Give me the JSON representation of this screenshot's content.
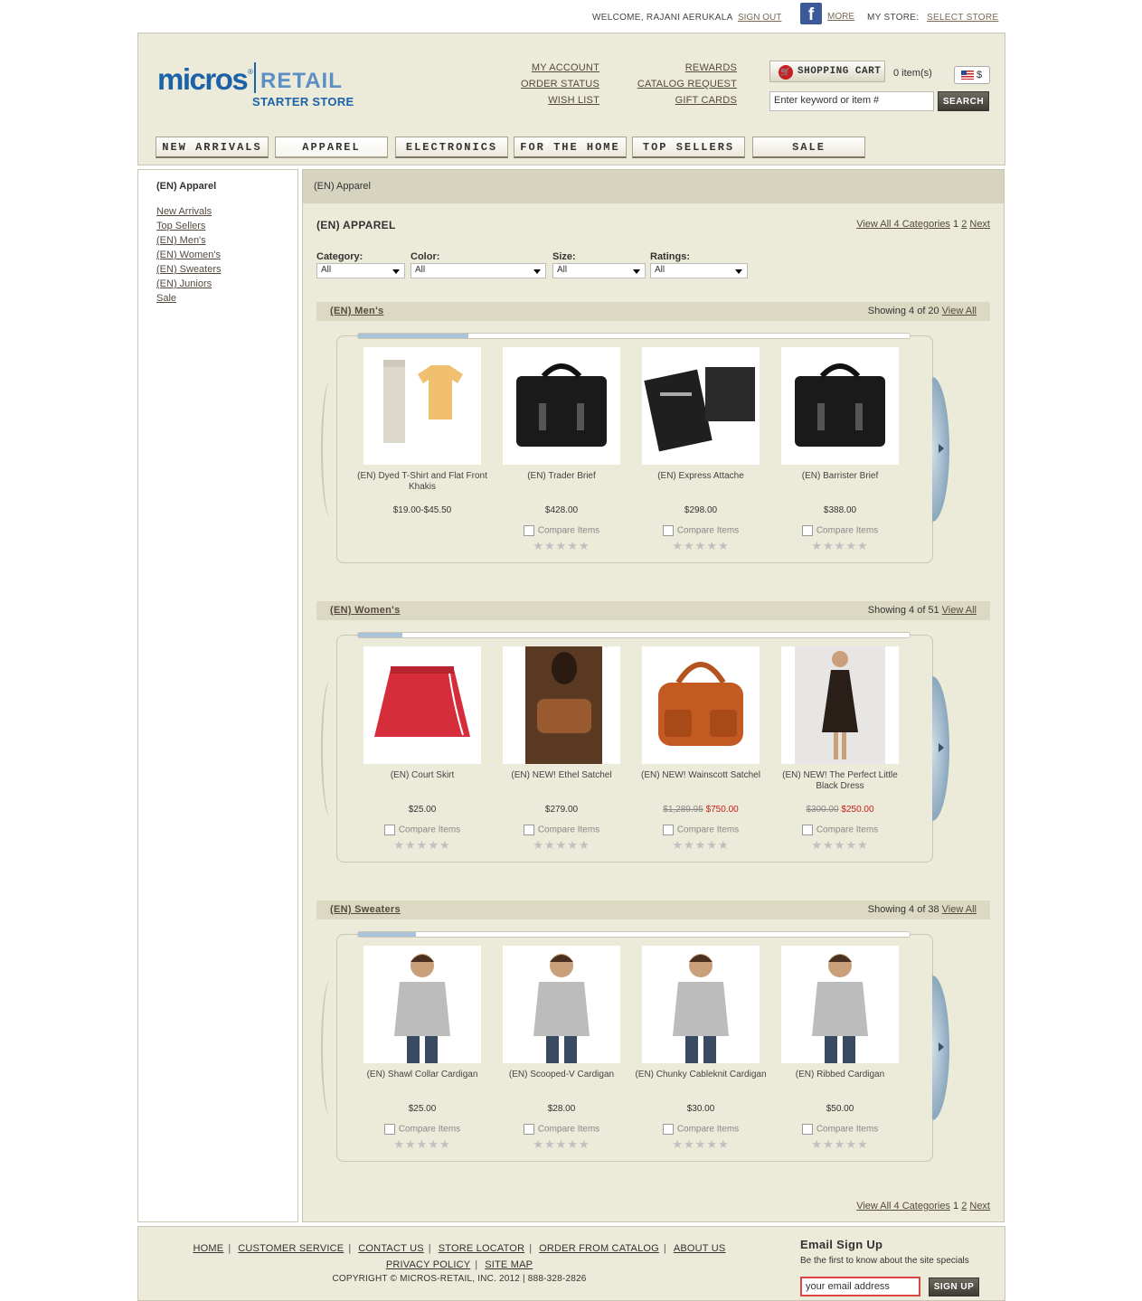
{
  "topbar": {
    "welcome": "WELCOME, RAJANI AERUKALA",
    "sign_out": "SIGN OUT",
    "fb_icon": "facebook-icon",
    "more": "MORE",
    "my_store": "MY STORE:",
    "select_store": "SELECT STORE"
  },
  "header": {
    "logo": {
      "micros": "micros",
      "reg": "®",
      "retail": "RETAIL",
      "subtitle": "STARTER STORE"
    },
    "links_left": [
      "MY ACCOUNT",
      "ORDER STATUS",
      "WISH LIST"
    ],
    "links_right": [
      "REWARDS",
      "CATALOG REQUEST",
      "GIFT CARDS"
    ],
    "cart_label": "SHOPPING CART",
    "cart_items": "0 item(s)",
    "currency": "$",
    "search_value": "Enter keyword or item #",
    "search_button": "SEARCH"
  },
  "nav": [
    "NEW ARRIVALS",
    "APPAREL",
    "ELECTRONICS",
    "FOR THE HOME",
    "TOP SELLERS",
    "SALE"
  ],
  "sidebar": {
    "title": "(EN) Apparel",
    "items": [
      "New Arrivals",
      "Top Sellers",
      "(EN) Men's",
      "(EN) Women's",
      "(EN) Sweaters",
      "(EN) Juniors",
      "Sale"
    ]
  },
  "main": {
    "breadcrumb": "(EN) Apparel",
    "title": "(EN) APPAREL",
    "pager": {
      "view_all": "View All 4 Categories",
      "p1": "1",
      "p2": "2",
      "next": "Next"
    },
    "filters": [
      {
        "label": "Category:",
        "value": "All"
      },
      {
        "label": "Color:",
        "value": "All"
      },
      {
        "label": "Size:",
        "value": "All"
      },
      {
        "label": "Ratings:",
        "value": "All"
      }
    ],
    "compare": "Compare Items",
    "stars": "★★★★★",
    "view_all": "View All",
    "sections": [
      {
        "name": "(EN) Men's",
        "showing": "Showing 4 of 20",
        "scroll_fraction": 0.2,
        "products": [
          {
            "name": "(EN) Dyed T-Shirt and Flat Front Khakis",
            "price": "$19.00-$45.50"
          },
          {
            "name": "(EN) Trader Brief",
            "price": "$428.00"
          },
          {
            "name": "(EN) Express Attache",
            "price": "$298.00"
          },
          {
            "name": "(EN) Barrister Brief",
            "price": "$388.00"
          }
        ]
      },
      {
        "name": "(EN) Women's",
        "showing": "Showing 4 of 51",
        "scroll_fraction": 0.08,
        "products": [
          {
            "name": "(EN) Court Skirt",
            "price": "$25.00"
          },
          {
            "name": "(EN) NEW! Ethel Satchel",
            "price": "$279.00"
          },
          {
            "name": "(EN) NEW! Wainscott Satchel",
            "old_price": "$1,289.95",
            "price": "$750.00"
          },
          {
            "name": "(EN) NEW! The Perfect Little Black Dress",
            "old_price": "$300.00",
            "price": "$250.00"
          }
        ]
      },
      {
        "name": "(EN) Sweaters",
        "showing": "Showing 4 of 38",
        "scroll_fraction": 0.105,
        "products": [
          {
            "name": "(EN) Shawl Collar Cardigan",
            "price": "$25.00"
          },
          {
            "name": "(EN) Scooped-V Cardigan",
            "price": "$28.00"
          },
          {
            "name": "(EN) Chunky Cableknit Cardigan",
            "price": "$30.00"
          },
          {
            "name": "(EN) Ribbed Cardigan",
            "price": "$50.00"
          }
        ]
      }
    ]
  },
  "footer": {
    "links": [
      "HOME",
      "CUSTOMER SERVICE",
      "CONTACT US",
      "STORE LOCATOR",
      "ORDER FROM CATALOG",
      "ABOUT US"
    ],
    "links2": [
      "PRIVACY POLICY",
      "SITE MAP"
    ],
    "copyright": "COPYRIGHT © MICROS-RETAIL, INC. 2012 | 888-328-2826",
    "email_title": "Email Sign Up",
    "email_text": "Be the first to know about the site specials",
    "email_value": "your email address",
    "signup": "SIGN UP"
  }
}
